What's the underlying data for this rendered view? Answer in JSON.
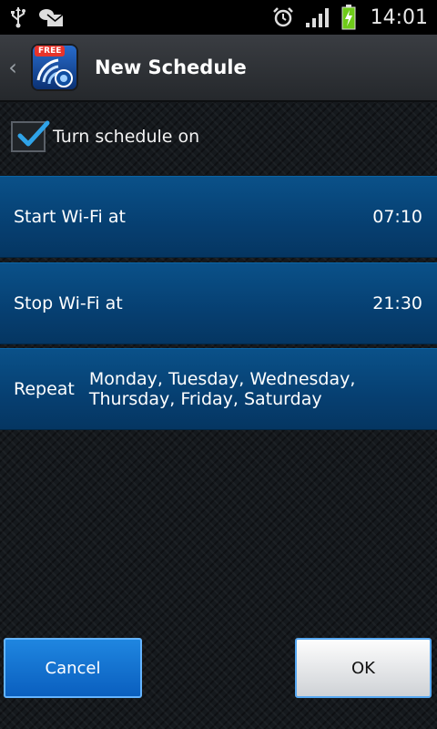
{
  "status_bar": {
    "time": "14:01",
    "icons": [
      "usb-icon",
      "mail-notification-icon",
      "alarm-icon",
      "signal-icon",
      "battery-charging-icon"
    ]
  },
  "title_bar": {
    "title": "New Schedule",
    "app_badge": "FREE"
  },
  "toggle": {
    "label": "Turn schedule on",
    "checked": true
  },
  "rows": {
    "start": {
      "label": "Start Wi-Fi at",
      "value": "07:10"
    },
    "stop": {
      "label": "Stop Wi-Fi at",
      "value": "21:30"
    },
    "repeat": {
      "label": "Repeat",
      "value": "Monday, Tuesday, Wednesday, Thursday, Friday, Saturday"
    }
  },
  "buttons": {
    "cancel": "Cancel",
    "ok": "OK"
  },
  "colors": {
    "row_blue": "#063f71",
    "accent": "#1f86e0",
    "battery_green": "#6ecb19"
  }
}
